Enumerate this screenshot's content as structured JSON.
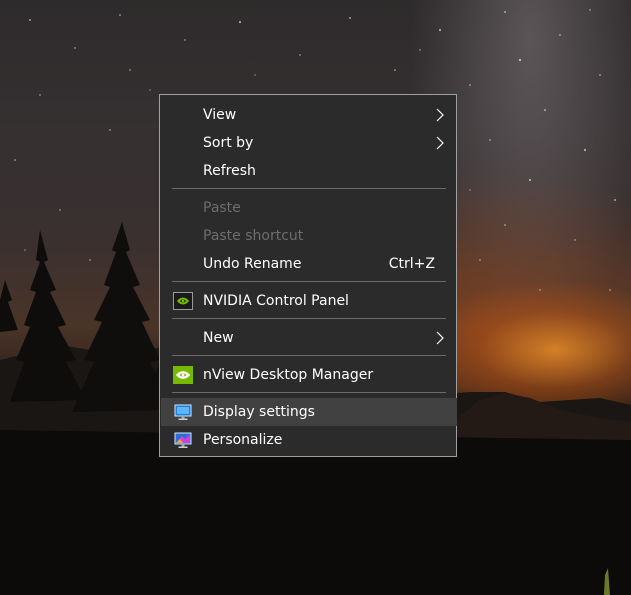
{
  "context_menu": {
    "items": [
      {
        "label": "View",
        "submenu": true
      },
      {
        "label": "Sort by",
        "submenu": true
      },
      {
        "label": "Refresh"
      },
      {
        "label": "Paste",
        "disabled": true
      },
      {
        "label": "Paste shortcut",
        "disabled": true
      },
      {
        "label": "Undo Rename",
        "shortcut": "Ctrl+Z"
      },
      {
        "label": "NVIDIA Control Panel",
        "icon": "nvidia-icon"
      },
      {
        "label": "New",
        "submenu": true
      },
      {
        "label": "nView Desktop Manager",
        "icon": "nview-icon"
      },
      {
        "label": "Display settings",
        "icon": "display-settings-icon",
        "highlighted": true
      },
      {
        "label": "Personalize",
        "icon": "personalize-icon"
      }
    ]
  },
  "colors": {
    "menu_background": "#2b2b2b",
    "menu_border": "#a0a0a0",
    "text": "#ffffff",
    "disabled_text": "#6d6d6d",
    "highlight": "#414141",
    "nvidia_green": "#76b900"
  }
}
